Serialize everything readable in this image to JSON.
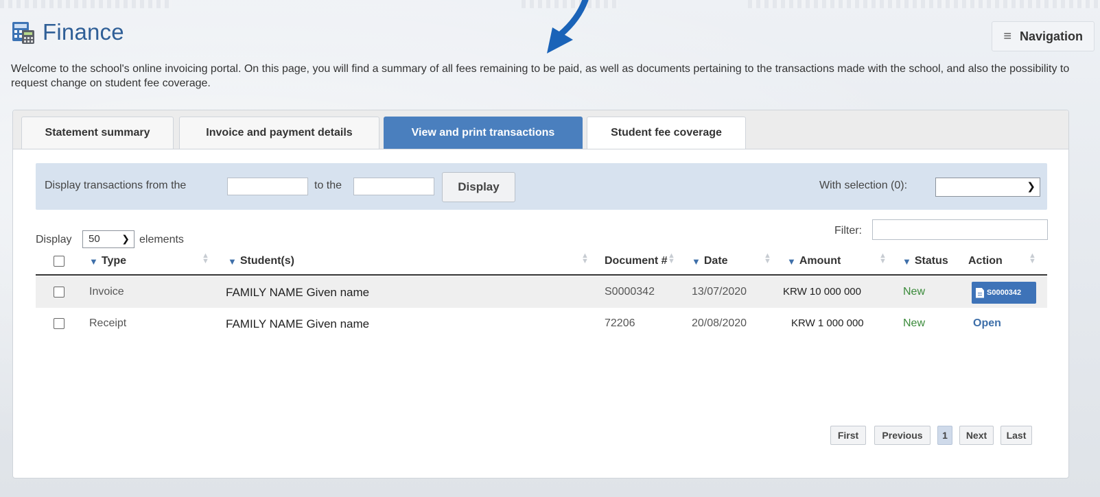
{
  "header": {
    "title": "Finance",
    "nav_label": "Navigation"
  },
  "intro": "Welcome to the school's online invoicing portal. On this page, you will find a summary of all fees remaining to be paid, as well as documents pertaining to the transactions made with the school, and also the possibility to request change on student fee coverage.",
  "tabs": [
    {
      "label": "Statement summary",
      "active": false
    },
    {
      "label": "Invoice and payment details",
      "active": false
    },
    {
      "label": "View and print transactions",
      "active": true
    },
    {
      "label": "Student fee coverage",
      "active": false
    }
  ],
  "filter": {
    "from_label": "Display transactions from the",
    "to_label": "to the",
    "from_value": "",
    "to_value": "",
    "display_button": "Display",
    "selection_label": "With selection (0):",
    "selection_value": ""
  },
  "table_controls": {
    "display_label": "Display",
    "page_length": "50",
    "elements_label": "elements",
    "filter_label": "Filter:",
    "filter_value": ""
  },
  "columns": {
    "type": "Type",
    "students": "Student(s)",
    "document": "Document #",
    "date": "Date",
    "amount": "Amount",
    "status": "Status",
    "action": "Action"
  },
  "rows": [
    {
      "type": "Invoice",
      "student": "FAMILY NAME Given name",
      "document": "S0000342",
      "date": "13/07/2020",
      "amount": "KRW 10 000 000",
      "status": "New",
      "action": "S0000342",
      "action_kind": "document-button"
    },
    {
      "type": "Receipt",
      "student": "FAMILY NAME Given name",
      "document": "72206",
      "date": "20/08/2020",
      "amount": "KRW 1 000 000",
      "status": "New",
      "action": "Open",
      "action_kind": "link"
    }
  ],
  "pagination": {
    "first": "First",
    "previous": "Previous",
    "current": "1",
    "next": "Next",
    "last": "Last"
  },
  "colors": {
    "accent": "#4a7fbe",
    "title": "#2f5f97",
    "status_new": "#3a8a3a",
    "annotation_arrow": "#1a63b8"
  },
  "icons": {
    "header": "finance-calculator-icon",
    "nav": "hamburger-menu-icon",
    "column_filter": "funnel-icon",
    "document": "document-icon",
    "annotation": "pointer-arrow"
  }
}
